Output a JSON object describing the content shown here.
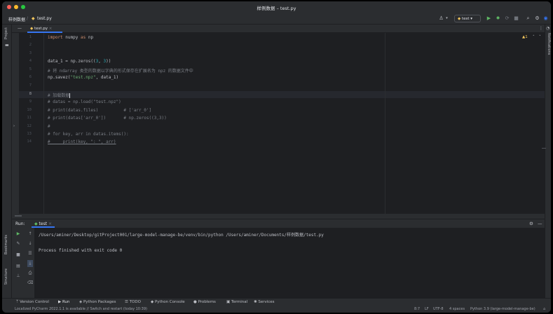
{
  "window": {
    "title": "样例数据 – test.py"
  },
  "navbar": {
    "project": "样例数据",
    "file": "test.py",
    "run_config": "test"
  },
  "left_strip": {
    "project": "Project",
    "bookmarks": "Bookmarks",
    "structure": "Structure"
  },
  "right_strip": {
    "notifications": "Notifications"
  },
  "editor_tab": {
    "name": "test.py"
  },
  "editor": {
    "inspection": "▲1",
    "line_numbers": [
      "1",
      "2",
      "3",
      "4",
      "5",
      "6",
      "7",
      "8",
      "9",
      "10",
      "11",
      "12",
      "13",
      "14"
    ],
    "lines": {
      "l1_kw1": "import",
      "l1_mod": " numpy ",
      "l1_kw2": "as",
      "l1_alias": " np",
      "l4_a": "data_1 = np.zeros((",
      "l4_n1": "3",
      "l4_b": ", ",
      "l4_n2": "3",
      "l4_c": "))",
      "l5": "# 将 ndarray 类型的数据以字典的形式保存在扩展名为 npz 的数据文件中",
      "l6_a": "np.savez(",
      "l6_s": "\"test.npz\"",
      "l6_b": ", data_1)",
      "l8": "# 加载数据",
      "l9": "# datas = np.load(\"test.npz\")",
      "l10": "# print(datas.files)          # ['arr_0']",
      "l11": "# print(datas['arr_0'])       # np.zeros((3,3))",
      "l12": "#",
      "l13": "# for key, arr in datas.items():",
      "l14": "#     print(key, \": \", arr)"
    }
  },
  "run_panel": {
    "label": "Run:",
    "tab": "test",
    "console_line1": "/Users/aminer/Desktop/gitProject001/large-model-manage-be/venv/bin/python /Users/aminer/Documents/样例数据/test.py",
    "console_line2": "Process finished with exit code 0"
  },
  "bottom_tools": [
    "Version Control",
    "Run",
    "Python Packages",
    "TODO",
    "Python Console",
    "Problems",
    "Terminal",
    "Services"
  ],
  "status": {
    "message": "Localized PyCharm 2022.1.1 is available // Switch and restart (today 10:39)",
    "position": "8:7",
    "line_sep": "LF",
    "encoding": "UTF-8",
    "indent": "4 spaces",
    "interpreter": "Python 3.9 (large-model-manage-be)"
  },
  "colors": {
    "accent": "#3574f0",
    "keyword": "#cf8e6d",
    "string": "#6aab73",
    "number": "#2aacb8",
    "comment": "#7a7e85",
    "run_green": "#5fb865"
  }
}
